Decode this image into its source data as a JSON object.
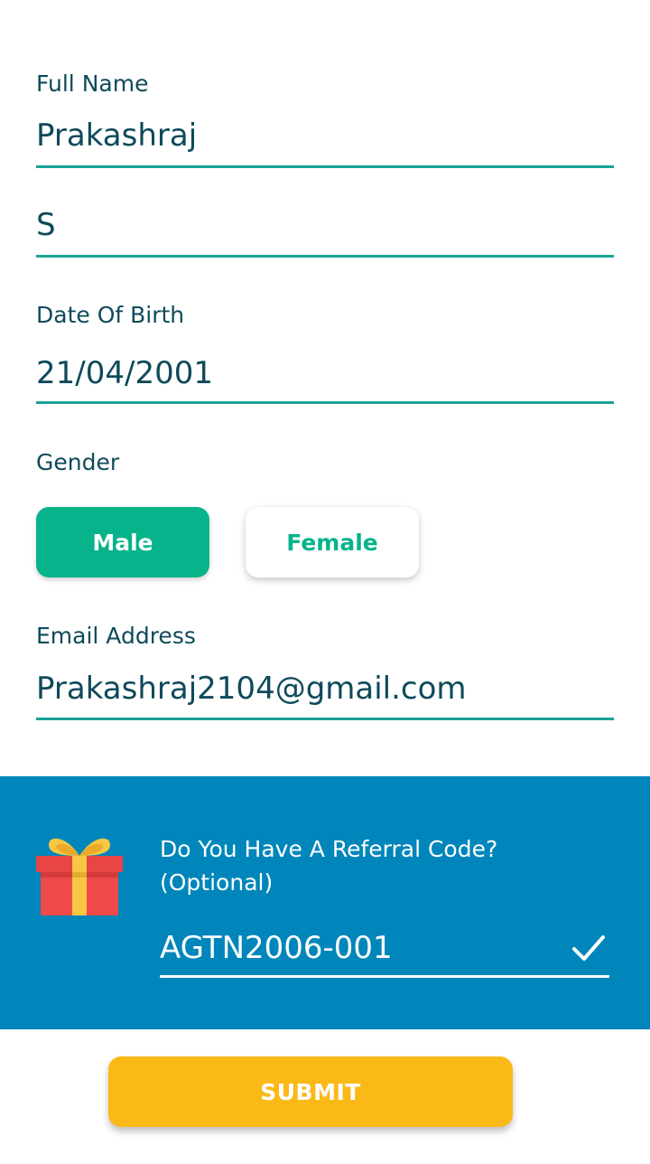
{
  "form": {
    "full_name_label": "Full Name",
    "first_name_value": "Prakashraj",
    "last_name_value": "S",
    "dob_label": "Date Of Birth",
    "dob_value": "21/04/2001",
    "gender_label": "Gender",
    "gender_options": [
      "Male",
      "Female"
    ],
    "gender_selected": "Male",
    "email_label": "Email Address",
    "email_value": "Prakashraj2104@gmail.com"
  },
  "referral": {
    "title_line1": "Do You Have A Referral Code?",
    "title_line2": "(Optional)",
    "code_value": "AGTN2006-001",
    "icon": "gift-icon",
    "confirm_icon": "check-icon"
  },
  "actions": {
    "submit_label": "SUBMIT"
  },
  "colors": {
    "accent_teal": "#1aa396",
    "male_selected": "#07b38b",
    "referral_bg": "#0086bb",
    "submit_bg": "#fbb917",
    "text_dark": "#0e4a5a"
  }
}
